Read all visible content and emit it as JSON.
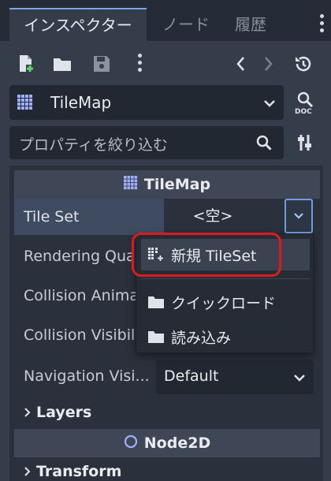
{
  "tabs": [
    {
      "label": "インスペクター"
    },
    {
      "label": "ノード"
    },
    {
      "label": "履歴"
    }
  ],
  "toolbar": {
    "icons": [
      "new-resource-icon",
      "open-folder-icon",
      "save-icon",
      "more-icon",
      "back-icon",
      "forward-icon",
      "history-icon"
    ]
  },
  "node": {
    "name": "TileMap"
  },
  "filter": {
    "placeholder": "プロパティを絞り込む"
  },
  "sections": {
    "tilemap": "TileMap",
    "node2d": "Node2D"
  },
  "properties": {
    "tile_set": {
      "label": "Tile Set",
      "value": "<空>"
    },
    "rendering_quadrant": {
      "label": "Rendering Quadrant Size"
    },
    "collision_animatable": {
      "label": "Collision Animatable"
    },
    "collision_visibility": {
      "label": "Collision Visibility Mode"
    },
    "navigation_visibility": {
      "label": "Navigation Visi...",
      "value": "Default"
    }
  },
  "groups": {
    "layers": "Layers",
    "transform": "Transform"
  },
  "popup": {
    "new_tileset": "新規 TileSet",
    "quick_load": "クイックロード",
    "load": "読み込み"
  },
  "colors": {
    "accent": "#7aa7e6",
    "highlight_box": "#e0191f",
    "background": "#363d4a"
  }
}
